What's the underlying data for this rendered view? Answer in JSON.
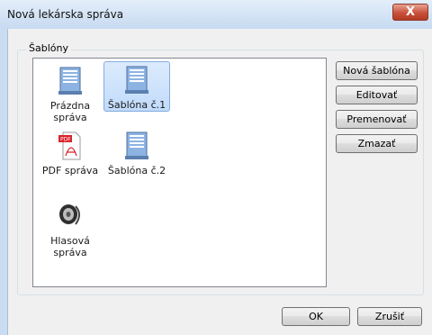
{
  "window": {
    "title": "Nová lekárska správa",
    "close_label": "X"
  },
  "group": {
    "title": "Šablóny"
  },
  "templates": [
    {
      "label": "Prázdna správa",
      "icon": "document-icon"
    },
    {
      "label": "Šablóna č.1",
      "icon": "document-icon",
      "selected": true
    },
    {
      "label": "PDF správa",
      "icon": "pdf-icon"
    },
    {
      "label": "Šablóna č.2",
      "icon": "document-icon"
    },
    {
      "label": "Hlasová správa",
      "icon": "speaker-icon"
    }
  ],
  "buttons": {
    "new_template": "Nová šablóna",
    "edit": "Editovať",
    "rename": "Premenovať",
    "delete": "Zmazať",
    "ok": "OK",
    "cancel": "Zrušiť"
  },
  "colors": {
    "selection": "#c1dbfc",
    "close": "#c9513b",
    "pdf_red": "#d8232a"
  }
}
